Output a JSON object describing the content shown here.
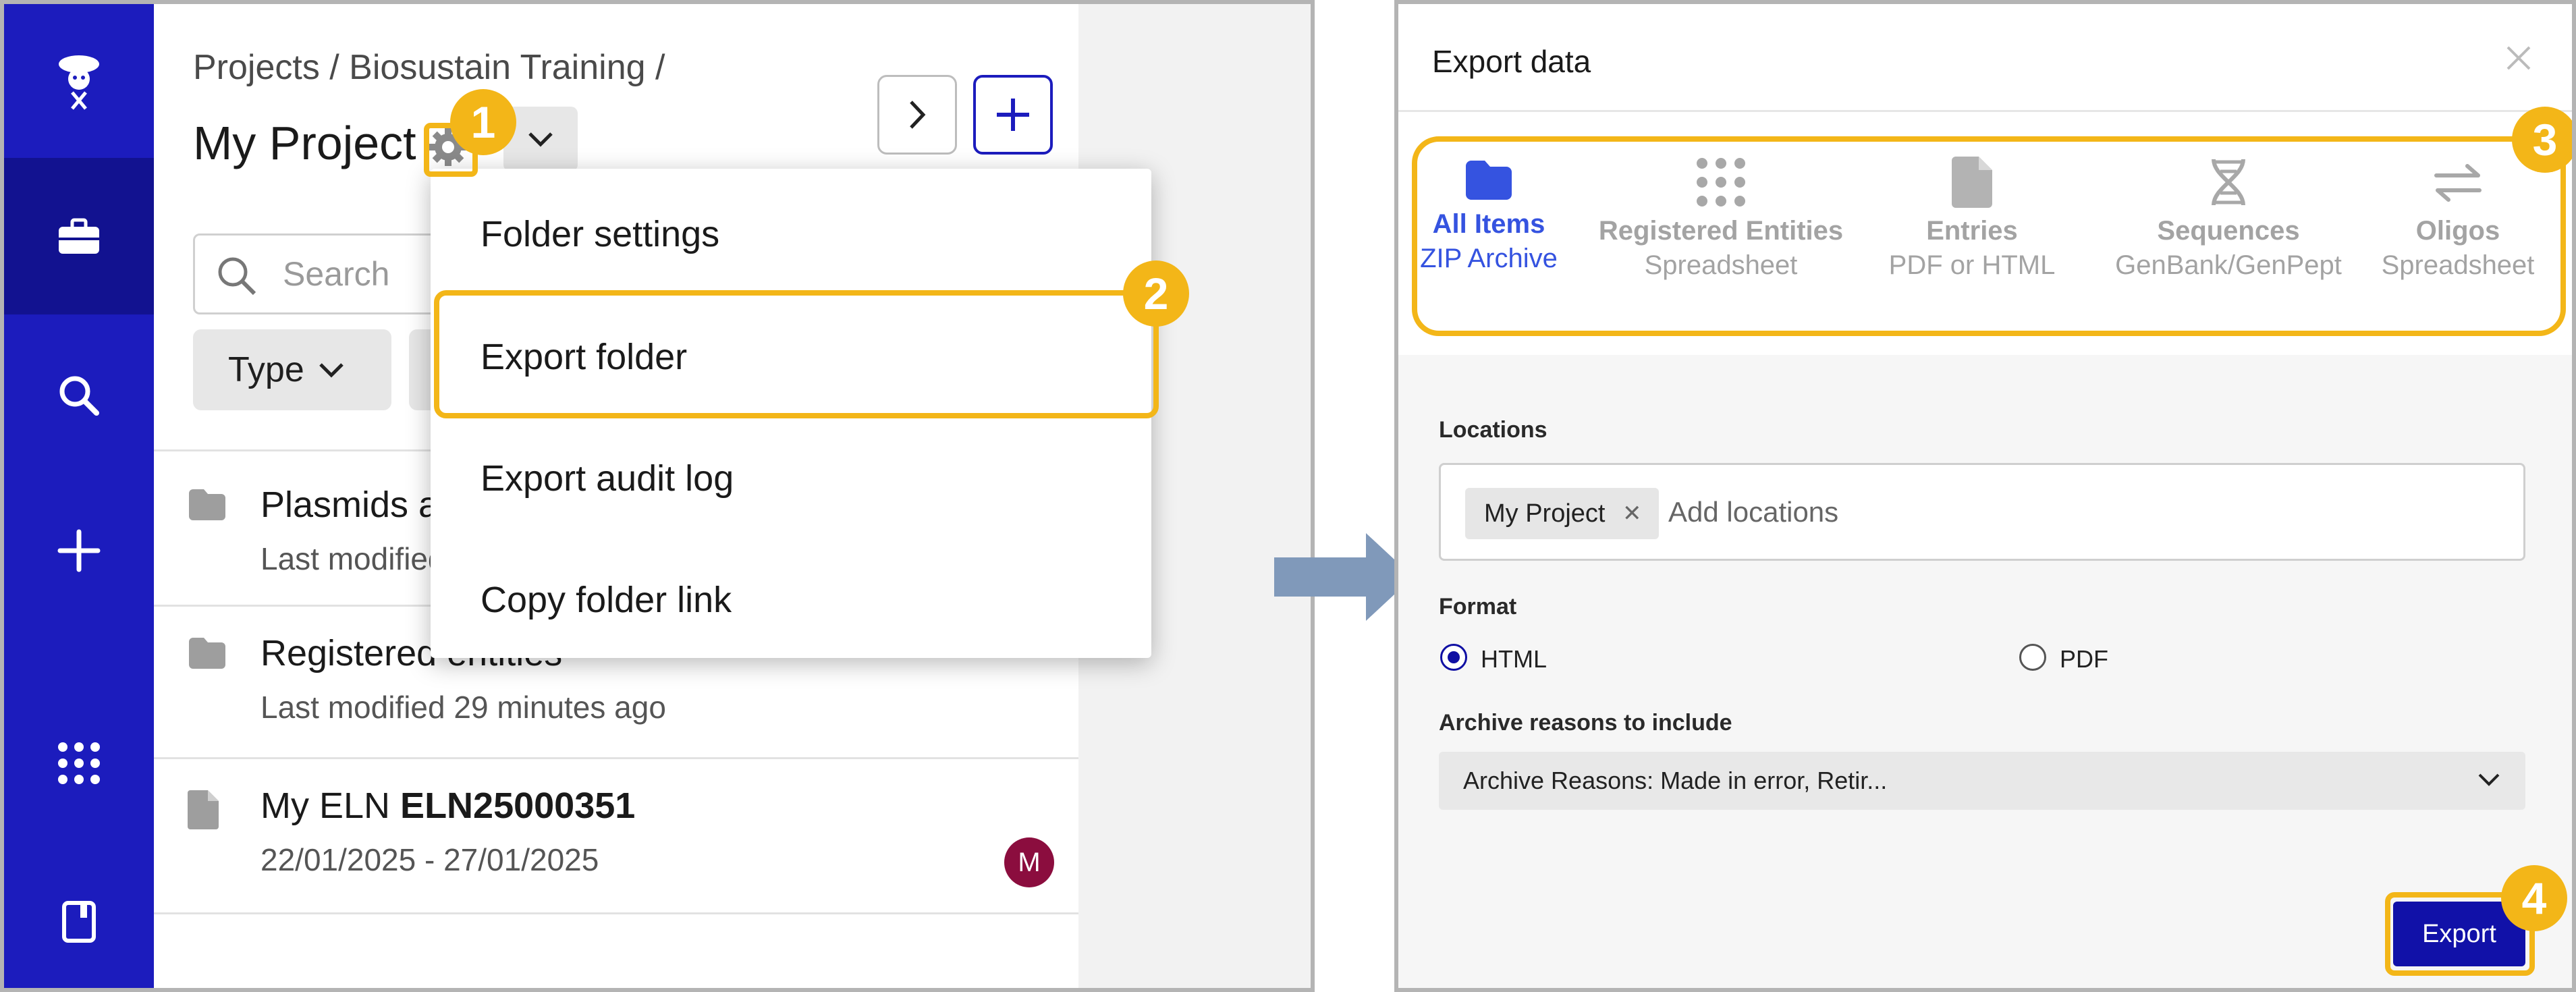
{
  "left": {
    "breadcrumb": "Projects / Biosustain Training /",
    "project_title": "My Project",
    "search_placeholder": "Search",
    "chips": [
      "Type"
    ],
    "list": [
      {
        "title": "Plasmids a",
        "subtitle": "Last modified",
        "icon": "folder-icon"
      },
      {
        "title": "Registered entities",
        "subtitle": "Last modified 29 minutes ago",
        "icon": "folder-icon"
      },
      {
        "title_prefix": "My ELN ",
        "title_bold": "ELN25000351",
        "subtitle": "22/01/2025 - 27/01/2025",
        "icon": "document-icon",
        "avatar": "M"
      }
    ],
    "menu": [
      "Folder settings",
      "Export folder",
      "Export audit log",
      "Copy folder link"
    ],
    "sidebar_icons": [
      "logo-icon",
      "briefcase-icon",
      "search-icon",
      "plus-icon",
      "apps-grid-icon",
      "notebook-icon"
    ]
  },
  "right": {
    "title": "Export data",
    "tabs": [
      {
        "label": "All Items",
        "sub": "ZIP Archive",
        "icon": "folder-icon"
      },
      {
        "label": "Registered Entities",
        "sub": "Spreadsheet",
        "icon": "dots-grid-icon"
      },
      {
        "label": "Entries",
        "sub": "PDF or HTML",
        "icon": "document-icon"
      },
      {
        "label": "Sequences",
        "sub": "GenBank/GenPept",
        "icon": "dna-icon"
      },
      {
        "label": "Oligos",
        "sub": "Spreadsheet",
        "icon": "swap-arrows-icon"
      }
    ],
    "locations_label": "Locations",
    "location_tag": "My Project",
    "location_placeholder": "Add locations",
    "format_label": "Format",
    "format_options": [
      "HTML",
      "PDF"
    ],
    "format_selected": "HTML",
    "archive_label": "Archive reasons to include",
    "archive_value": "Archive Reasons: Made in error, Retir...",
    "export_label": "Export"
  },
  "badges": [
    "1",
    "2",
    "3",
    "4"
  ],
  "colors": {
    "brand": "#1c1cbd",
    "brand_dark": "#121290",
    "highlight": "#f3b618",
    "active_tab": "#3553e0",
    "export_btn": "#1111a8",
    "avatar": "#8b0d3e"
  }
}
